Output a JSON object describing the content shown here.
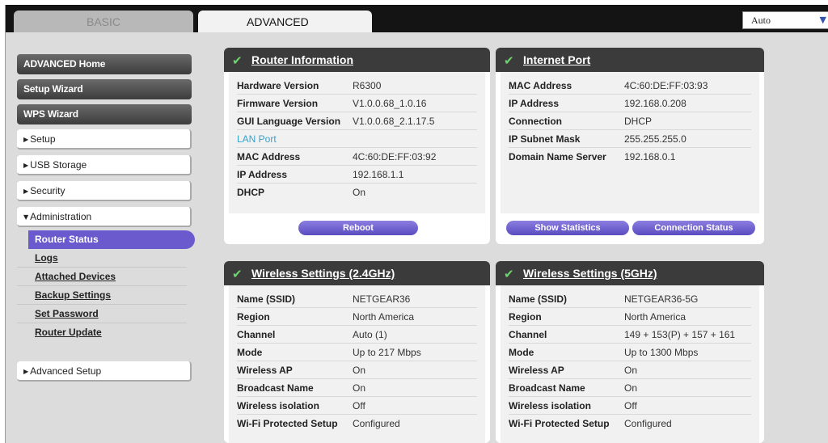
{
  "tabs": {
    "basic": "BASIC",
    "advanced": "ADVANCED"
  },
  "language": {
    "selected": "Auto"
  },
  "sidebar": {
    "advanced_home": "ADVANCED Home",
    "setup_wizard": "Setup Wizard",
    "wps_wizard": "WPS Wizard",
    "setup": "Setup",
    "usb_storage": "USB Storage",
    "security": "Security",
    "administration": "Administration",
    "admin_items": [
      "Router Status",
      "Logs",
      "Attached Devices",
      "Backup Settings",
      "Set Password",
      "Router Update"
    ],
    "advanced_setup": "Advanced Setup"
  },
  "router_info": {
    "title": "Router Information",
    "rows": [
      {
        "k": "Hardware Version",
        "v": "R6300"
      },
      {
        "k": "Firmware Version",
        "v": "V1.0.0.68_1.0.16"
      },
      {
        "k": "GUI Language Version",
        "v": "V1.0.0.68_2.1.17.5"
      }
    ],
    "lan_port_label": "LAN Port",
    "lan_rows": [
      {
        "k": "MAC Address",
        "v": "4C:60:DE:FF:03:92"
      },
      {
        "k": "IP Address",
        "v": "192.168.1.1"
      },
      {
        "k": "DHCP",
        "v": "On"
      }
    ],
    "reboot_button": "Reboot"
  },
  "internet_port": {
    "title": "Internet Port",
    "rows": [
      {
        "k": "MAC Address",
        "v": "4C:60:DE:FF:03:93"
      },
      {
        "k": "IP Address",
        "v": "192.168.0.208"
      },
      {
        "k": "Connection",
        "v": "DHCP"
      },
      {
        "k": "IP Subnet Mask",
        "v": "255.255.255.0"
      },
      {
        "k": "Domain Name Server",
        "v": "192.168.0.1"
      }
    ],
    "show_statistics_button": "Show Statistics",
    "connection_status_button": "Connection Status"
  },
  "wireless_24": {
    "title": "Wireless Settings (2.4GHz)",
    "rows": [
      {
        "k": "Name (SSID)",
        "v": "NETGEAR36"
      },
      {
        "k": "Region",
        "v": "North America"
      },
      {
        "k": "Channel",
        "v": "Auto (1)"
      },
      {
        "k": "Mode",
        "v": "Up to 217 Mbps"
      },
      {
        "k": "Wireless AP",
        "v": "On"
      },
      {
        "k": "Broadcast Name",
        "v": "On"
      },
      {
        "k": "Wireless isolation",
        "v": "Off"
      },
      {
        "k": "Wi-Fi Protected Setup",
        "v": "Configured"
      }
    ]
  },
  "wireless_5": {
    "title": "Wireless Settings (5GHz)",
    "rows": [
      {
        "k": "Name (SSID)",
        "v": "NETGEAR36-5G"
      },
      {
        "k": "Region",
        "v": "North America"
      },
      {
        "k": "Channel",
        "v": "149 + 153(P) + 157 + 161"
      },
      {
        "k": "Mode",
        "v": "Up to 1300 Mbps"
      },
      {
        "k": "Wireless AP",
        "v": "On"
      },
      {
        "k": "Broadcast Name",
        "v": "On"
      },
      {
        "k": "Wireless isolation",
        "v": "Off"
      },
      {
        "k": "Wi-Fi Protected Setup",
        "v": "Configured"
      }
    ]
  }
}
